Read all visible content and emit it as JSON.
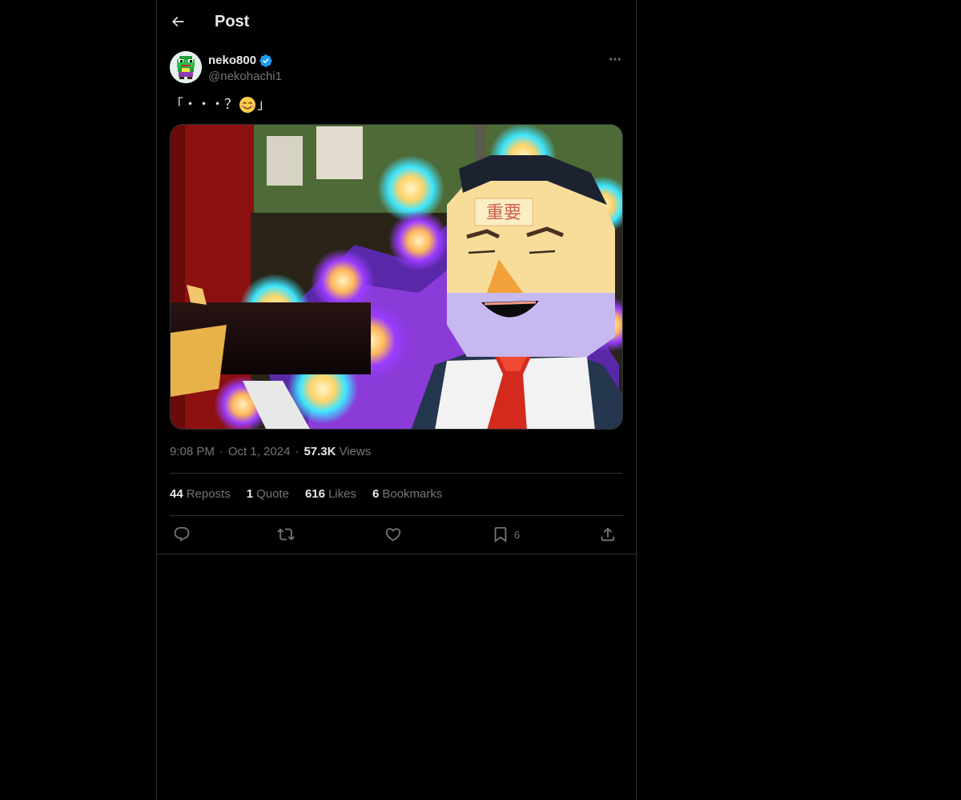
{
  "header": {
    "back_icon": "arrow-left-icon",
    "title": "Post"
  },
  "author": {
    "display_name": "neko800",
    "verified_icon": "verified-badge-icon",
    "handle": "@nekohachi1",
    "more_icon": "more-horizontal-icon"
  },
  "post": {
    "text_before": "「・・・？",
    "emoji": "smiling-face-icon",
    "text_after": "」",
    "media_caption": "重要"
  },
  "meta": {
    "time": "9:08 PM",
    "separator": "·",
    "date": "Oct 1, 2024",
    "views_count": "57.3K",
    "views_label": "Views"
  },
  "stats": {
    "reposts_count": "44",
    "reposts_label": "Reposts",
    "quotes_count": "1",
    "quotes_label": "Quote",
    "likes_count": "616",
    "likes_label": "Likes",
    "bookmarks_count": "6",
    "bookmarks_label": "Bookmarks"
  },
  "actions": {
    "reply_icon": "reply-icon",
    "repost_icon": "repost-icon",
    "like_icon": "heart-icon",
    "bookmark_icon": "bookmark-icon",
    "bookmark_count": "6",
    "share_icon": "share-icon"
  },
  "colors": {
    "background": "#000000",
    "text_primary": "#e7e9ea",
    "text_secondary": "#71767b",
    "border": "#2f3336",
    "verified": "#1d9bf0"
  }
}
